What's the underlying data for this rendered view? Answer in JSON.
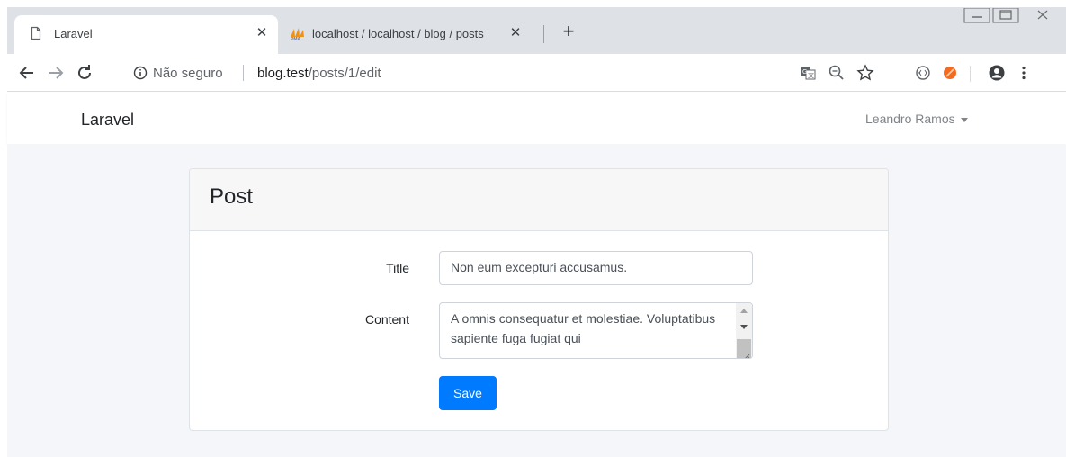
{
  "browser": {
    "tabs": [
      {
        "title": "Laravel",
        "active": true,
        "icon": "page-icon"
      },
      {
        "title": "localhost / localhost / blog / posts",
        "active": false,
        "icon": "phpmyadmin-icon"
      }
    ],
    "new_tab_icon": "plus-icon",
    "address": {
      "security_text": "Não seguro",
      "url_host": "blog.test",
      "url_path": "/posts/1/edit"
    }
  },
  "app": {
    "brand": "Laravel",
    "user_name": "Leandro Ramos"
  },
  "card": {
    "title": "Post",
    "form": {
      "title_label": "Title",
      "title_value": "Non eum excepturi accusamus.",
      "content_label": "Content",
      "content_value": "A omnis consequatur et molestiae. Voluptatibus sapiente fuga fugiat qui",
      "save_label": "Save"
    }
  },
  "colors": {
    "primary": "#007bff",
    "page_bg": "#f4f6f9",
    "tabstrip_bg": "#dee1e6"
  }
}
